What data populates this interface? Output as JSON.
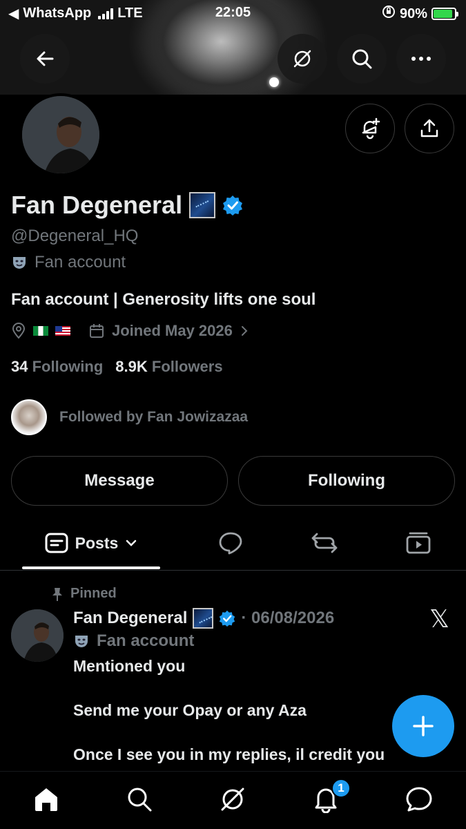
{
  "status_bar": {
    "back_app": "WhatsApp",
    "network": "LTE",
    "time": "22:05",
    "battery": "90%",
    "battery_level": 0.9
  },
  "profile": {
    "name": "Fan Degeneral",
    "handle": "@Degeneral_HQ",
    "affiliation": "Fan account",
    "bio": "Fan account | Generosity lifts one soul",
    "joined": "Joined May 2026",
    "following_count": "34",
    "following_label": "Following",
    "followers_count": "8.9K",
    "followers_label": "Followers",
    "followed_by": "Followed by Fan Jowizazaa",
    "verified_color": "#1d9bf0"
  },
  "actions": {
    "message_label": "Message",
    "following_label": "Following"
  },
  "tabs": {
    "posts_label": "Posts"
  },
  "post": {
    "pinned_label": "Pinned",
    "author": "Fan Degeneral",
    "date": "· 06/08/2026",
    "affiliation": "Fan account",
    "lines": [
      "Mentioned you",
      "Send me your Opay or any Aza",
      "Once I see you in my replies, il credit you"
    ]
  },
  "bottom_nav": {
    "notification_badge": "1"
  },
  "colors": {
    "accent": "#1d9bf0",
    "background": "#000000",
    "muted_text": "#71767b"
  }
}
